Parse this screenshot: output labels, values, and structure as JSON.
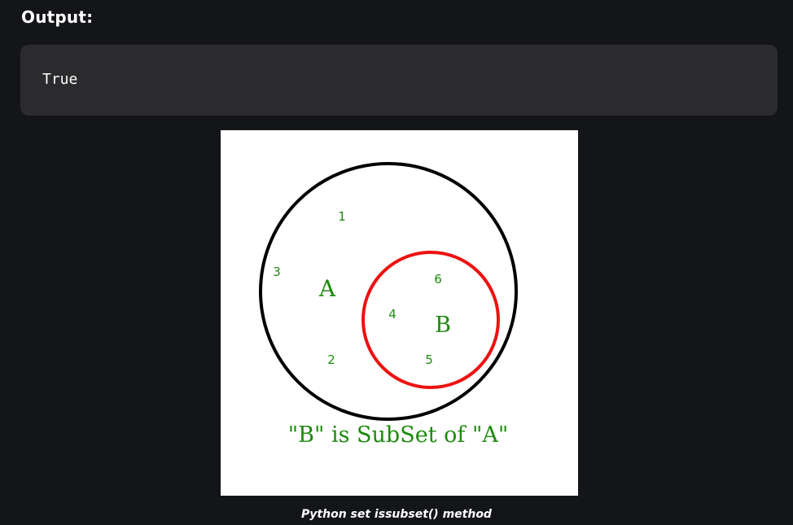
{
  "output": {
    "heading": "Output:",
    "code": "True"
  },
  "figure": {
    "set_a_label": "A",
    "set_b_label": "B",
    "a_only_elements": [
      "1",
      "3",
      "2"
    ],
    "b_elements": [
      "6",
      "4",
      "5"
    ],
    "diagram_caption": "\"B\" is SubSet of \"A\"",
    "colors": {
      "outer_circle": "#000000",
      "inner_circle": "#ee1111",
      "text": "#1e8a0e",
      "background": "#ffffff"
    }
  },
  "caption": "Python set issubset() method"
}
